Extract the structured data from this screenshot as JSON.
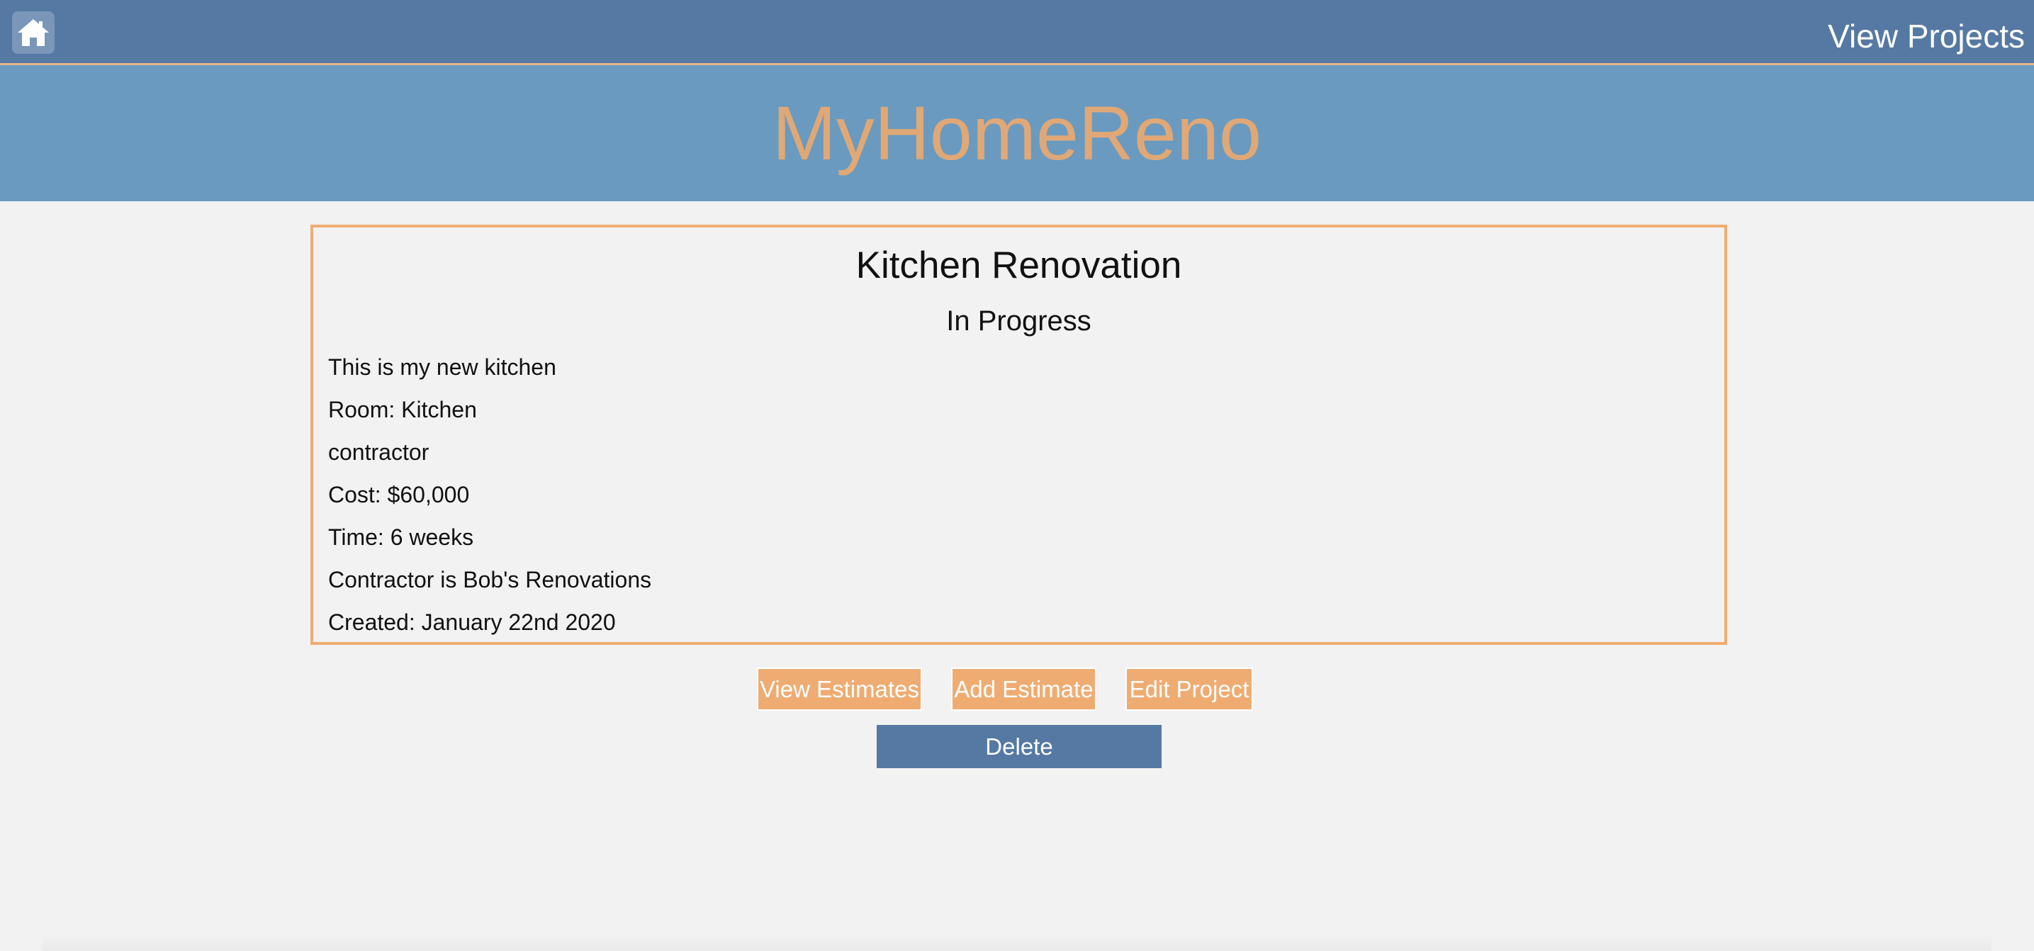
{
  "nav": {
    "home_icon": "home-icon",
    "view_projects_label": "View Projects"
  },
  "header": {
    "brand": "MyHomeReno"
  },
  "project": {
    "title": "Kitchen Renovation",
    "status": "In Progress",
    "description": "This is my new kitchen",
    "room": "Room: Kitchen",
    "type": "contractor",
    "cost": "Cost: $60,000",
    "time": "Time: 6 weeks",
    "contractor": "Contractor is Bob's Renovations",
    "created": "Created: January 22nd 2020"
  },
  "actions": {
    "view_estimates_label": "View Estimates",
    "add_estimate_label": "Add Estimate",
    "edit_project_label": "Edit Project",
    "delete_label": "Delete"
  },
  "colors": {
    "topbar": "#5579a3",
    "banner": "#6a9abf",
    "brand_text": "#e0a877",
    "accent_orange": "#efac72",
    "delete_button": "#5579a3",
    "background": "#f2f2f2"
  }
}
